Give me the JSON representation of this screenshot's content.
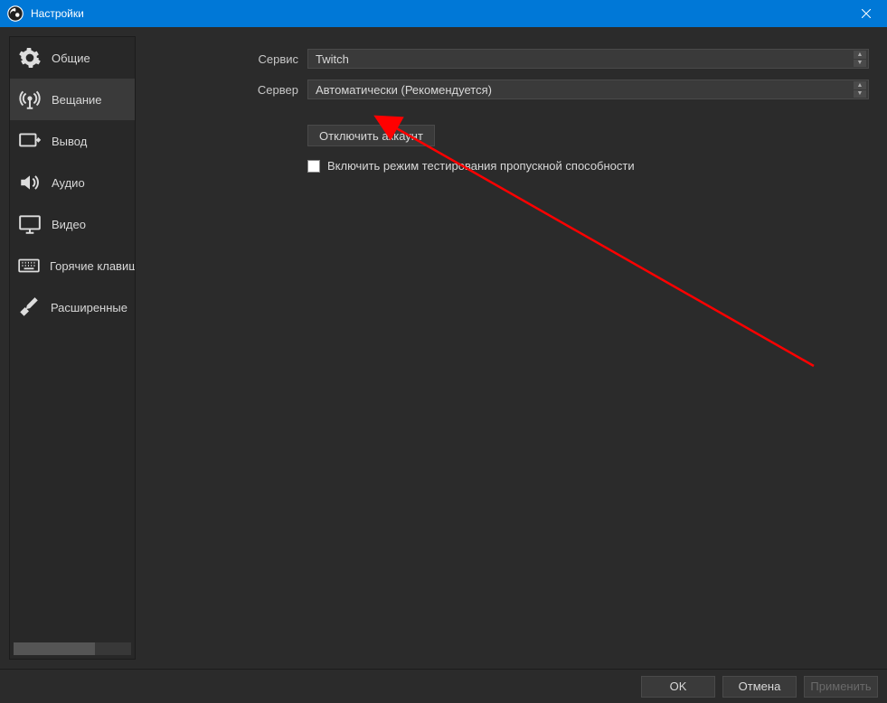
{
  "window": {
    "title": "Настройки"
  },
  "sidebar": {
    "items": [
      {
        "label": "Общие"
      },
      {
        "label": "Вещание"
      },
      {
        "label": "Вывод"
      },
      {
        "label": "Аудио"
      },
      {
        "label": "Видео"
      },
      {
        "label": "Горячие клавиши"
      },
      {
        "label": "Расширенные"
      }
    ],
    "selected_index": 1
  },
  "form": {
    "service_label": "Сервис",
    "service_value": "Twitch",
    "server_label": "Сервер",
    "server_value": "Автоматически (Рекомендуется)",
    "disconnect_button": "Отключить аккаунт",
    "bandwidth_checkbox_label": "Включить режим тестирования пропускной способности",
    "bandwidth_checked": false
  },
  "footer": {
    "ok": "OK",
    "cancel": "Отмена",
    "apply": "Применить"
  }
}
